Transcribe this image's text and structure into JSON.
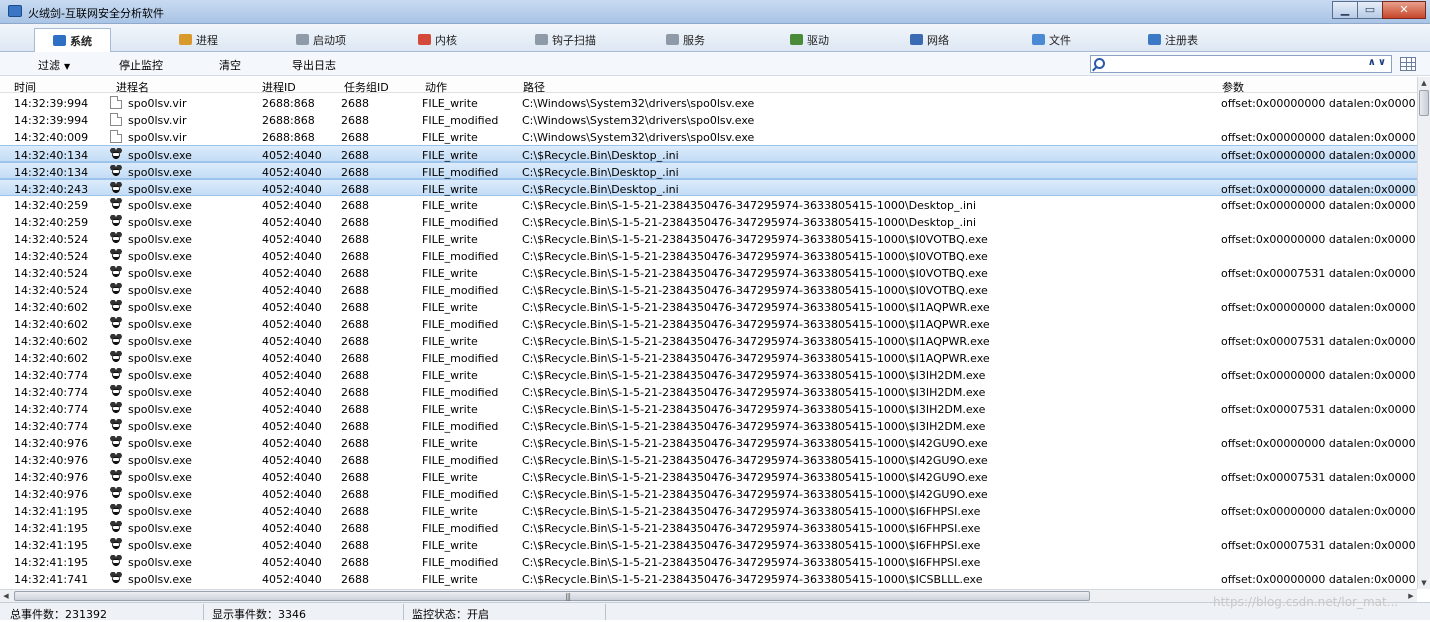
{
  "window": {
    "title": "火绒剑-互联网安全分析软件"
  },
  "tabs": [
    {
      "label": "系统",
      "icon": "monitor-icon",
      "color": "#2f6fc4",
      "active": true
    },
    {
      "label": "进程",
      "icon": "process-icon",
      "color": "#d89a2a"
    },
    {
      "label": "启动项",
      "icon": "startup-icon",
      "color": "#8f9aa8"
    },
    {
      "label": "内核",
      "icon": "kernel-icon",
      "color": "#d34a3a"
    },
    {
      "label": "钩子扫描",
      "icon": "hook-icon",
      "color": "#8f9aa8"
    },
    {
      "label": "服务",
      "icon": "service-icon",
      "color": "#8f9aa8"
    },
    {
      "label": "驱动",
      "icon": "driver-icon",
      "color": "#4a8b3a"
    },
    {
      "label": "网络",
      "icon": "network-icon",
      "color": "#3a6ab4"
    },
    {
      "label": "文件",
      "icon": "file-icon",
      "color": "#4a8ad4"
    },
    {
      "label": "注册表",
      "icon": "registry-icon",
      "color": "#3a7ac4"
    }
  ],
  "toolbar": {
    "filter": "过滤",
    "stop": "停止监控",
    "clear": "清空",
    "export": "导出日志",
    "search_value": ""
  },
  "columns": {
    "time": "时间",
    "name": "进程名",
    "pid": "进程ID",
    "task": "任务组ID",
    "action": "动作",
    "path": "路径",
    "param": "参数"
  },
  "rows": [
    {
      "time": "14:32:39:994",
      "name": "spo0lsv.vir",
      "icon": "doc",
      "pid": "2688:868",
      "task": "2688",
      "action": "FILE_write",
      "path": "C:\\Windows\\System32\\drivers\\spo0lsv.exe",
      "param": "offset:0x00000000 datalen:0x0000"
    },
    {
      "time": "14:32:39:994",
      "name": "spo0lsv.vir",
      "icon": "doc",
      "pid": "2688:868",
      "task": "2688",
      "action": "FILE_modified",
      "path": "C:\\Windows\\System32\\drivers\\spo0lsv.exe",
      "param": ""
    },
    {
      "time": "14:32:40:009",
      "name": "spo0lsv.vir",
      "icon": "doc",
      "pid": "2688:868",
      "task": "2688",
      "action": "FILE_write",
      "path": "C:\\Windows\\System32\\drivers\\spo0lsv.exe",
      "param": "offset:0x00000000 datalen:0x0000"
    },
    {
      "time": "14:32:40:134",
      "name": "spo0lsv.exe",
      "icon": "bug",
      "pid": "4052:4040",
      "task": "2688",
      "action": "FILE_write",
      "path": "C:\\$Recycle.Bin\\Desktop_.ini",
      "param": "offset:0x00000000 datalen:0x0000",
      "selected": true
    },
    {
      "time": "14:32:40:134",
      "name": "spo0lsv.exe",
      "icon": "bug",
      "pid": "4052:4040",
      "task": "2688",
      "action": "FILE_modified",
      "path": "C:\\$Recycle.Bin\\Desktop_.ini",
      "param": "",
      "selected": true
    },
    {
      "time": "14:32:40:243",
      "name": "spo0lsv.exe",
      "icon": "bug",
      "pid": "4052:4040",
      "task": "2688",
      "action": "FILE_write",
      "path": "C:\\$Recycle.Bin\\Desktop_.ini",
      "param": "offset:0x00000000 datalen:0x0000",
      "selected": true
    },
    {
      "time": "14:32:40:259",
      "name": "spo0lsv.exe",
      "icon": "bug",
      "pid": "4052:4040",
      "task": "2688",
      "action": "FILE_write",
      "path": "C:\\$Recycle.Bin\\S-1-5-21-2384350476-347295974-3633805415-1000\\Desktop_.ini",
      "param": "offset:0x00000000 datalen:0x0000"
    },
    {
      "time": "14:32:40:259",
      "name": "spo0lsv.exe",
      "icon": "bug",
      "pid": "4052:4040",
      "task": "2688",
      "action": "FILE_modified",
      "path": "C:\\$Recycle.Bin\\S-1-5-21-2384350476-347295974-3633805415-1000\\Desktop_.ini",
      "param": ""
    },
    {
      "time": "14:32:40:524",
      "name": "spo0lsv.exe",
      "icon": "bug",
      "pid": "4052:4040",
      "task": "2688",
      "action": "FILE_write",
      "path": "C:\\$Recycle.Bin\\S-1-5-21-2384350476-347295974-3633805415-1000\\$I0VOTBQ.exe",
      "param": "offset:0x00000000 datalen:0x0000"
    },
    {
      "time": "14:32:40:524",
      "name": "spo0lsv.exe",
      "icon": "bug",
      "pid": "4052:4040",
      "task": "2688",
      "action": "FILE_modified",
      "path": "C:\\$Recycle.Bin\\S-1-5-21-2384350476-347295974-3633805415-1000\\$I0VOTBQ.exe",
      "param": ""
    },
    {
      "time": "14:32:40:524",
      "name": "spo0lsv.exe",
      "icon": "bug",
      "pid": "4052:4040",
      "task": "2688",
      "action": "FILE_write",
      "path": "C:\\$Recycle.Bin\\S-1-5-21-2384350476-347295974-3633805415-1000\\$I0VOTBQ.exe",
      "param": "offset:0x00007531 datalen:0x0000"
    },
    {
      "time": "14:32:40:524",
      "name": "spo0lsv.exe",
      "icon": "bug",
      "pid": "4052:4040",
      "task": "2688",
      "action": "FILE_modified",
      "path": "C:\\$Recycle.Bin\\S-1-5-21-2384350476-347295974-3633805415-1000\\$I0VOTBQ.exe",
      "param": ""
    },
    {
      "time": "14:32:40:602",
      "name": "spo0lsv.exe",
      "icon": "bug",
      "pid": "4052:4040",
      "task": "2688",
      "action": "FILE_write",
      "path": "C:\\$Recycle.Bin\\S-1-5-21-2384350476-347295974-3633805415-1000\\$I1AQPWR.exe",
      "param": "offset:0x00000000 datalen:0x0000"
    },
    {
      "time": "14:32:40:602",
      "name": "spo0lsv.exe",
      "icon": "bug",
      "pid": "4052:4040",
      "task": "2688",
      "action": "FILE_modified",
      "path": "C:\\$Recycle.Bin\\S-1-5-21-2384350476-347295974-3633805415-1000\\$I1AQPWR.exe",
      "param": ""
    },
    {
      "time": "14:32:40:602",
      "name": "spo0lsv.exe",
      "icon": "bug",
      "pid": "4052:4040",
      "task": "2688",
      "action": "FILE_write",
      "path": "C:\\$Recycle.Bin\\S-1-5-21-2384350476-347295974-3633805415-1000\\$I1AQPWR.exe",
      "param": "offset:0x00007531 datalen:0x0000"
    },
    {
      "time": "14:32:40:602",
      "name": "spo0lsv.exe",
      "icon": "bug",
      "pid": "4052:4040",
      "task": "2688",
      "action": "FILE_modified",
      "path": "C:\\$Recycle.Bin\\S-1-5-21-2384350476-347295974-3633805415-1000\\$I1AQPWR.exe",
      "param": ""
    },
    {
      "time": "14:32:40:774",
      "name": "spo0lsv.exe",
      "icon": "bug",
      "pid": "4052:4040",
      "task": "2688",
      "action": "FILE_write",
      "path": "C:\\$Recycle.Bin\\S-1-5-21-2384350476-347295974-3633805415-1000\\$I3IH2DM.exe",
      "param": "offset:0x00000000 datalen:0x0000"
    },
    {
      "time": "14:32:40:774",
      "name": "spo0lsv.exe",
      "icon": "bug",
      "pid": "4052:4040",
      "task": "2688",
      "action": "FILE_modified",
      "path": "C:\\$Recycle.Bin\\S-1-5-21-2384350476-347295974-3633805415-1000\\$I3IH2DM.exe",
      "param": ""
    },
    {
      "time": "14:32:40:774",
      "name": "spo0lsv.exe",
      "icon": "bug",
      "pid": "4052:4040",
      "task": "2688",
      "action": "FILE_write",
      "path": "C:\\$Recycle.Bin\\S-1-5-21-2384350476-347295974-3633805415-1000\\$I3IH2DM.exe",
      "param": "offset:0x00007531 datalen:0x0000"
    },
    {
      "time": "14:32:40:774",
      "name": "spo0lsv.exe",
      "icon": "bug",
      "pid": "4052:4040",
      "task": "2688",
      "action": "FILE_modified",
      "path": "C:\\$Recycle.Bin\\S-1-5-21-2384350476-347295974-3633805415-1000\\$I3IH2DM.exe",
      "param": ""
    },
    {
      "time": "14:32:40:976",
      "name": "spo0lsv.exe",
      "icon": "bug",
      "pid": "4052:4040",
      "task": "2688",
      "action": "FILE_write",
      "path": "C:\\$Recycle.Bin\\S-1-5-21-2384350476-347295974-3633805415-1000\\$I42GU9O.exe",
      "param": "offset:0x00000000 datalen:0x0000"
    },
    {
      "time": "14:32:40:976",
      "name": "spo0lsv.exe",
      "icon": "bug",
      "pid": "4052:4040",
      "task": "2688",
      "action": "FILE_modified",
      "path": "C:\\$Recycle.Bin\\S-1-5-21-2384350476-347295974-3633805415-1000\\$I42GU9O.exe",
      "param": ""
    },
    {
      "time": "14:32:40:976",
      "name": "spo0lsv.exe",
      "icon": "bug",
      "pid": "4052:4040",
      "task": "2688",
      "action": "FILE_write",
      "path": "C:\\$Recycle.Bin\\S-1-5-21-2384350476-347295974-3633805415-1000\\$I42GU9O.exe",
      "param": "offset:0x00007531 datalen:0x0000"
    },
    {
      "time": "14:32:40:976",
      "name": "spo0lsv.exe",
      "icon": "bug",
      "pid": "4052:4040",
      "task": "2688",
      "action": "FILE_modified",
      "path": "C:\\$Recycle.Bin\\S-1-5-21-2384350476-347295974-3633805415-1000\\$I42GU9O.exe",
      "param": ""
    },
    {
      "time": "14:32:41:195",
      "name": "spo0lsv.exe",
      "icon": "bug",
      "pid": "4052:4040",
      "task": "2688",
      "action": "FILE_write",
      "path": "C:\\$Recycle.Bin\\S-1-5-21-2384350476-347295974-3633805415-1000\\$I6FHPSI.exe",
      "param": "offset:0x00000000 datalen:0x0000"
    },
    {
      "time": "14:32:41:195",
      "name": "spo0lsv.exe",
      "icon": "bug",
      "pid": "4052:4040",
      "task": "2688",
      "action": "FILE_modified",
      "path": "C:\\$Recycle.Bin\\S-1-5-21-2384350476-347295974-3633805415-1000\\$I6FHPSI.exe",
      "param": ""
    },
    {
      "time": "14:32:41:195",
      "name": "spo0lsv.exe",
      "icon": "bug",
      "pid": "4052:4040",
      "task": "2688",
      "action": "FILE_write",
      "path": "C:\\$Recycle.Bin\\S-1-5-21-2384350476-347295974-3633805415-1000\\$I6FHPSI.exe",
      "param": "offset:0x00007531 datalen:0x0000"
    },
    {
      "time": "14:32:41:195",
      "name": "spo0lsv.exe",
      "icon": "bug",
      "pid": "4052:4040",
      "task": "2688",
      "action": "FILE_modified",
      "path": "C:\\$Recycle.Bin\\S-1-5-21-2384350476-347295974-3633805415-1000\\$I6FHPSI.exe",
      "param": ""
    },
    {
      "time": "14:32:41:741",
      "name": "spo0lsv.exe",
      "icon": "bug",
      "pid": "4052:4040",
      "task": "2688",
      "action": "FILE_write",
      "path": "C:\\$Recycle.Bin\\S-1-5-21-2384350476-347295974-3633805415-1000\\$ICSBLLL.exe",
      "param": "offset:0x00000000 datalen:0x0000"
    }
  ],
  "status": {
    "total": "总事件数：231392",
    "shown": "显示事件数：3346",
    "monitor": "监控状态：开启"
  },
  "watermark": "https://blog.csdn.net/lor_mat..."
}
